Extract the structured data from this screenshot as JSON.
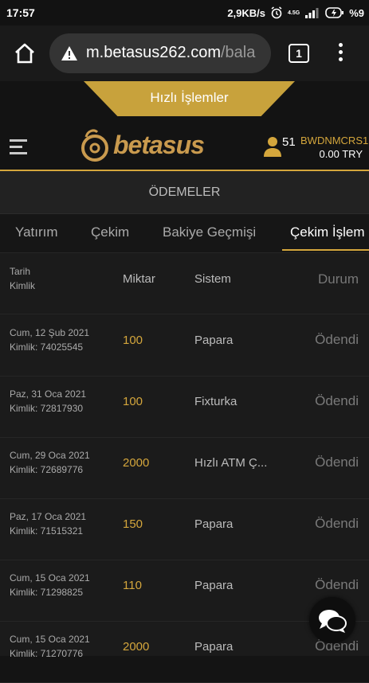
{
  "status_bar": {
    "time": "17:57",
    "speed": "2,9KB/s",
    "network": "4.5G",
    "battery": "%9"
  },
  "browser": {
    "url_main": "m.betasus262.com",
    "url_rest": "/bala",
    "tab_count": "1"
  },
  "site": {
    "quick_button": "Hızlı İşlemler",
    "logo_text": "betasus",
    "user_count": "51",
    "username": "BWDNMCRS1",
    "balance": "0.00 TRY"
  },
  "section_title": "ÖDEMELER",
  "tabs": [
    {
      "label": "Yatırım"
    },
    {
      "label": "Çekim"
    },
    {
      "label": "Bakiye Geçmişi"
    },
    {
      "label": "Çekim İşlem"
    }
  ],
  "table": {
    "headers": {
      "date": "Tarih",
      "id": "Kimlik",
      "amount": "Miktar",
      "system": "Sistem",
      "status": "Durum"
    },
    "rows": [
      {
        "date": "Cum, 12 Şub 2021",
        "id": "Kimlik: 74025545",
        "amount": "100",
        "system": "Papara",
        "status": "Ödendi"
      },
      {
        "date": "Paz, 31 Oca 2021",
        "id": "Kimlik: 72817930",
        "amount": "100",
        "system": "Fixturka",
        "status": "Ödendi"
      },
      {
        "date": "Cum, 29 Oca 2021",
        "id": "Kimlik: 72689776",
        "amount": "2000",
        "system": "Hızlı ATM Ç...",
        "status": "Ödendi"
      },
      {
        "date": "Paz, 17 Oca 2021",
        "id": "Kimlik: 71515321",
        "amount": "150",
        "system": "Papara",
        "status": "Ödendi"
      },
      {
        "date": "Cum, 15 Oca 2021",
        "id": "Kimlik: 71298825",
        "amount": "110",
        "system": "Papara",
        "status": "Ödendi"
      },
      {
        "date": "Cum, 15 Oca 2021",
        "id": "Kimlik: 71270776",
        "amount": "2000",
        "system": "Papara",
        "status": "Ödendi"
      }
    ]
  },
  "colors": {
    "accent": "#d4a63c",
    "background": "#141414"
  },
  "icons": [
    "home-icon",
    "warning-icon",
    "tabs-icon",
    "menu-icon",
    "hamburger-icon",
    "user-icon",
    "chat-icon"
  ]
}
